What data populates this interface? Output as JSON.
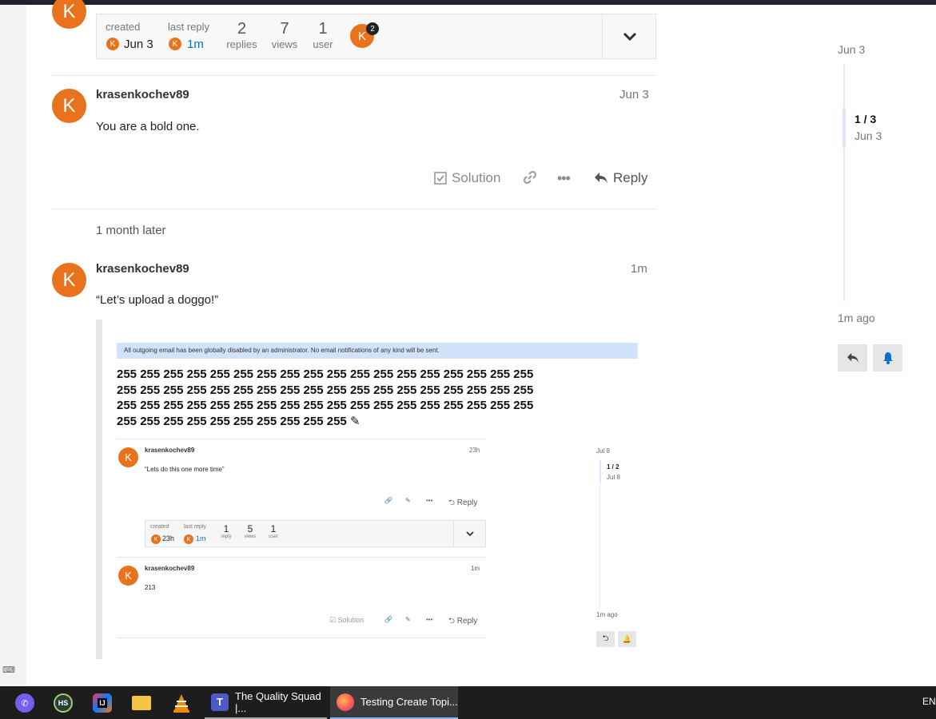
{
  "topic_map": {
    "created_label": "created",
    "created_date": "Jun 3",
    "last_reply_label": "last reply",
    "last_reply_date": "1m",
    "replies_count": "2",
    "replies_label": "replies",
    "views_count": "7",
    "views_label": "views",
    "users_count": "1",
    "users_label": "user",
    "participant_badge": "2",
    "avatar_letter": "K"
  },
  "posts": [
    {
      "username": "krasenkochev89",
      "date": "Jun 3",
      "body": "You are a bold one.",
      "avatar_letter": "K",
      "actions": {
        "solution": "Solution",
        "reply": "Reply"
      }
    },
    {
      "username": "krasenkochev89",
      "date": "1m",
      "body": "“Let’s upload a doggo!”",
      "avatar_letter": "K"
    }
  ],
  "time_gap": "1 month later",
  "timeline": {
    "start_date": "Jun 3",
    "position": "1 / 3",
    "position_date": "Jun 3",
    "end_label": "1m ago"
  },
  "embedded": {
    "banner": "All outgoing email has been globally disabled by an administrator. No email notifications of any kind will be sent.",
    "title_lines": [
      "255 255 255 255 255 255 255 255 255 255 255 255 255 255 255 255 255 255",
      "255 255 255 255 255 255 255 255 255 255 255 255 255 255 255 255 255 255",
      "255 255 255 255 255 255 255 255 255 255 255 255 255 255 255 255 255 255",
      "255 255 255 255 255 255 255 255 255 255"
    ],
    "post1": {
      "username": "krasenkochev89",
      "date": "23h",
      "body": "“Lets do this one more time”",
      "reply": "Reply",
      "avatar_letter": "K"
    },
    "map": {
      "created_label": "created",
      "created_date": "23h",
      "last_reply_label": "last reply",
      "last_reply_date": "1m",
      "reply_count": "1",
      "reply_label": "reply",
      "views_count": "5",
      "views_label": "views",
      "users_count": "1",
      "users_label": "user"
    },
    "post2": {
      "username": "krasenkochev89",
      "date": "1m",
      "body": "213",
      "solution": "Solution",
      "reply": "Reply",
      "avatar_letter": "K"
    },
    "timeline": {
      "start_date": "Jul 8",
      "position": "1 / 2",
      "position_date": "Jul 8",
      "end_label": "1m ago"
    }
  },
  "taskbar": {
    "apps": [
      {
        "icon": "viber-icon",
        "label": ""
      },
      {
        "icon": "hubstaff-icon",
        "label": "HS"
      },
      {
        "icon": "intellij-icon",
        "label": "IJ"
      },
      {
        "icon": "file-explorer-icon",
        "label": ""
      },
      {
        "icon": "vlc-icon",
        "label": ""
      }
    ],
    "windows": [
      {
        "icon": "teams-icon",
        "label": "The Quality Squad |..."
      },
      {
        "icon": "firefox-icon",
        "label": "Testing Create Topi..."
      }
    ],
    "language": "EN"
  },
  "colors": {
    "avatar": "#e9731c",
    "accent_blue": "#0a6fd1",
    "banner_bg": "#d1e2fb"
  }
}
